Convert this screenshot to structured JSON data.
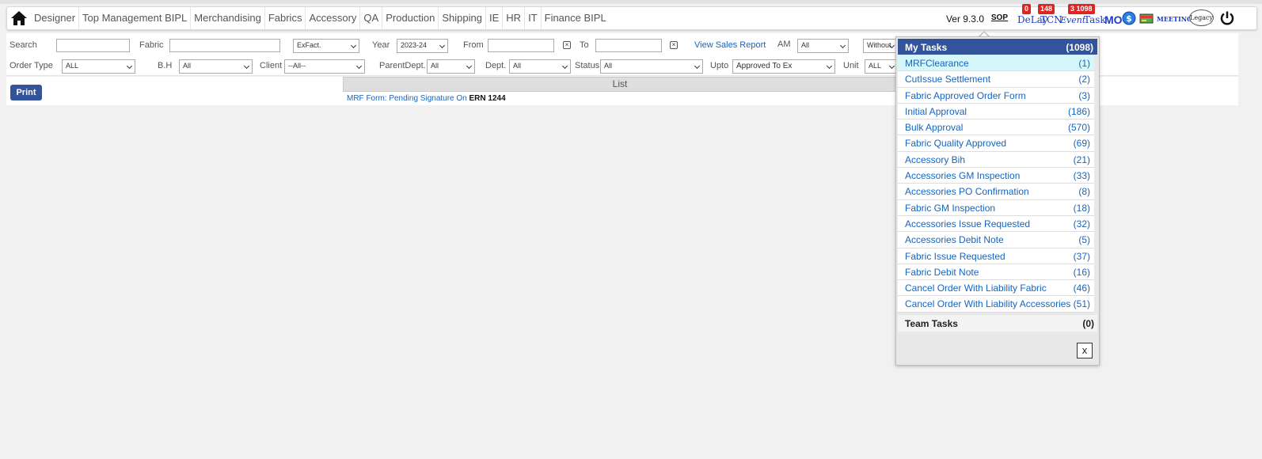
{
  "nav": {
    "menu": [
      "Designer",
      "Top Management BIPL",
      "Merchandising",
      "Fabrics",
      "Accessory",
      "QA",
      "Production",
      "Shipping",
      "IE",
      "HR",
      "IT",
      "Finance BIPL"
    ],
    "version": "Ver 9.3.0",
    "sop": "SOP",
    "delay": {
      "label": "DeLay",
      "count": "0"
    },
    "tcn": {
      "label": "TCN",
      "count": "148"
    },
    "event": {
      "label": "Event"
    },
    "task": {
      "label": "Task",
      "count": "3",
      "count2": "1098"
    },
    "mo_label": "MO",
    "meetings_label": "MEETINGS",
    "legacy_label": "Legacy"
  },
  "filters": {
    "search_label": "Search",
    "fabric_label": "Fabric",
    "exfact_value": "ExFact.",
    "year_label": "Year",
    "year_value": "2023-24",
    "from_label": "From",
    "to_label": "To",
    "view_sales_report": "View Sales Report",
    "am_label": "AM",
    "am_value": "All",
    "without_value": "Without",
    "order_type_label": "Order Type",
    "order_type_value": "ALL",
    "bh_label": "B.H",
    "bh_value": "All",
    "client_label": "Client",
    "client_value": "--All--",
    "parent_dept_label": "ParentDept.",
    "parent_dept_value": "All",
    "dept_label": "Dept.",
    "dept_value": "All",
    "status_label": "Status",
    "status_value": "All",
    "upto_label": "Upto",
    "upto_value": "Approved To Ex",
    "unit_label": "Unit",
    "unit_value": "ALL"
  },
  "content": {
    "print_label": "Print",
    "list_header": "List",
    "row_link": "MRF Form: Pending Signature On",
    "row_ern": "ERN 1244"
  },
  "tasks": {
    "my_tasks_label": "My Tasks",
    "my_tasks_count": "(1098)",
    "items": [
      {
        "name": "MRFClearance",
        "count": "(1)"
      },
      {
        "name": "CutIssue Settlement",
        "count": "(2)"
      },
      {
        "name": "Fabric Approved Order Form",
        "count": "(3)"
      },
      {
        "name": "Initial Approval",
        "count": "(186)"
      },
      {
        "name": "Bulk Approval",
        "count": "(570)"
      },
      {
        "name": "Fabric Quality Approved",
        "count": "(69)"
      },
      {
        "name": "Accessory Bih",
        "count": "(21)"
      },
      {
        "name": "Accessories GM Inspection",
        "count": "(33)"
      },
      {
        "name": "Accessories PO Confirmation",
        "count": "(8)"
      },
      {
        "name": "Fabric GM Inspection",
        "count": "(18)"
      },
      {
        "name": "Accessories Issue Requested",
        "count": "(32)"
      },
      {
        "name": "Accessories Debit Note",
        "count": "(5)"
      },
      {
        "name": "Fabric Issue Requested",
        "count": "(37)"
      },
      {
        "name": "Fabric Debit Note",
        "count": "(16)"
      },
      {
        "name": "Cancel Order With Liability Fabric",
        "count": "(46)"
      },
      {
        "name": "Cancel Order With Liability Accessories",
        "count": "(51)"
      }
    ],
    "team_tasks_label": "Team Tasks",
    "team_tasks_count": "(0)",
    "close_label": "x"
  },
  "colors": {
    "nav_blue": "#33549b",
    "link_blue": "#1565c0",
    "badge_red": "#e02424",
    "active_row": "#d5f7fb"
  }
}
